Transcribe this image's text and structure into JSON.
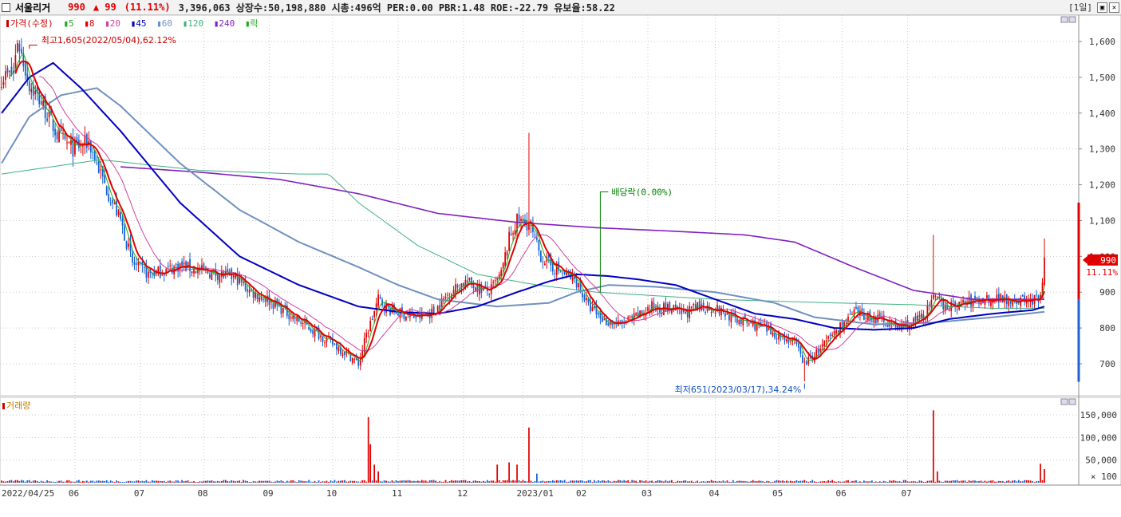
{
  "header": {
    "stock_name": "서울리거",
    "price": "990",
    "change": "▲ 99",
    "change_pct": "(11.11%)",
    "stats": "3,396,063  상장수:50,198,880  시총:496억  PER:0.00  PBR:1.48  ROE:-22.79  유보율:58.22",
    "timeframe": "[1일]"
  },
  "colors": {
    "up": "#e00000",
    "down": "#1060d0",
    "ma5": "#22aa22",
    "ma8": "#e00000",
    "ma20": "#d040a0",
    "ma45": "#0000c0",
    "ma60": "#7090c0",
    "ma120": "#40b080",
    "ma240": "#8020c0"
  },
  "legend": {
    "price": "가격(수정)",
    "ma5": "5",
    "ma8": "8",
    "ma20": "20",
    "ma45": "45",
    "ma60": "60",
    "ma120": "120",
    "ma240": "240",
    "event": "락"
  },
  "annotations": {
    "high": "최고1,605(2022/05/04),62.12%",
    "low": "최저651(2023/03/17),34.24%",
    "dividend": "배당락(0.00%)"
  },
  "price_tag": {
    "value": "990",
    "pct": "11.11%"
  },
  "volume_panel": {
    "title": "거래량",
    "unit": "× 100"
  },
  "chart_data": [
    {
      "type": "candlestick",
      "title": "",
      "ylim": [
        620,
        1650
      ],
      "y_ticks": [
        "1,600",
        "1,500",
        "1,400",
        "1,300",
        "1,200",
        "1,100",
        "1,000",
        "900",
        "800",
        "700"
      ],
      "x_tick_labels": [
        "2022/04/25",
        "06",
        "07",
        "08",
        "09",
        "10",
        "11",
        "12",
        "2023/01",
        "02",
        "03",
        "04",
        "05",
        "06",
        "07"
      ],
      "price_keypoints": [
        [
          0,
          1500
        ],
        [
          6,
          1510
        ],
        [
          8,
          1605
        ],
        [
          14,
          1480
        ],
        [
          20,
          1430
        ],
        [
          28,
          1340
        ],
        [
          36,
          1300
        ],
        [
          44,
          1320
        ],
        [
          52,
          1200
        ],
        [
          60,
          1100
        ],
        [
          66,
          980
        ],
        [
          74,
          950
        ],
        [
          82,
          960
        ],
        [
          90,
          975
        ],
        [
          100,
          960
        ],
        [
          110,
          950
        ],
        [
          118,
          940
        ],
        [
          126,
          900
        ],
        [
          134,
          880
        ],
        [
          142,
          850
        ],
        [
          150,
          820
        ],
        [
          158,
          790
        ],
        [
          166,
          760
        ],
        [
          174,
          730
        ],
        [
          180,
          700
        ],
        [
          184,
          780
        ],
        [
          190,
          880
        ],
        [
          196,
          850
        ],
        [
          202,
          840
        ],
        [
          210,
          830
        ],
        [
          218,
          845
        ],
        [
          226,
          900
        ],
        [
          234,
          930
        ],
        [
          240,
          915
        ],
        [
          246,
          900
        ],
        [
          252,
          950
        ],
        [
          256,
          1050
        ],
        [
          260,
          1100
        ],
        [
          266,
          1090
        ],
        [
          272,
          1000
        ],
        [
          278,
          970
        ],
        [
          284,
          950
        ],
        [
          290,
          930
        ],
        [
          296,
          860
        ],
        [
          304,
          820
        ],
        [
          312,
          810
        ],
        [
          320,
          830
        ],
        [
          328,
          860
        ],
        [
          336,
          855
        ],
        [
          344,
          840
        ],
        [
          352,
          860
        ],
        [
          360,
          855
        ],
        [
          368,
          830
        ],
        [
          376,
          815
        ],
        [
          384,
          800
        ],
        [
          392,
          780
        ],
        [
          400,
          760
        ],
        [
          405,
          700
        ],
        [
          410,
          725
        ],
        [
          416,
          760
        ],
        [
          422,
          800
        ],
        [
          430,
          840
        ],
        [
          438,
          830
        ],
        [
          446,
          820
        ],
        [
          452,
          800
        ],
        [
          460,
          815
        ],
        [
          466,
          840
        ],
        [
          470,
          880
        ],
        [
          474,
          870
        ],
        [
          478,
          860
        ],
        [
          486,
          870
        ],
        [
          494,
          880
        ],
        [
          502,
          885
        ],
        [
          510,
          880
        ],
        [
          518,
          875
        ],
        [
          524,
          880
        ],
        [
          526,
          990
        ]
      ],
      "ma45_keypoints": [
        [
          0,
          1400
        ],
        [
          14,
          1500
        ],
        [
          26,
          1540
        ],
        [
          40,
          1470
        ],
        [
          60,
          1350
        ],
        [
          90,
          1150
        ],
        [
          120,
          1000
        ],
        [
          150,
          920
        ],
        [
          180,
          860
        ],
        [
          200,
          845
        ],
        [
          220,
          840
        ],
        [
          240,
          860
        ],
        [
          260,
          900
        ],
        [
          276,
          930
        ],
        [
          290,
          950
        ],
        [
          306,
          945
        ],
        [
          322,
          935
        ],
        [
          340,
          920
        ],
        [
          360,
          880
        ],
        [
          380,
          840
        ],
        [
          400,
          825
        ],
        [
          420,
          800
        ],
        [
          440,
          795
        ],
        [
          460,
          800
        ],
        [
          478,
          825
        ],
        [
          500,
          840
        ],
        [
          520,
          850
        ],
        [
          526,
          860
        ]
      ],
      "ma60_keypoints": [
        [
          0,
          1260
        ],
        [
          14,
          1390
        ],
        [
          30,
          1450
        ],
        [
          48,
          1470
        ],
        [
          60,
          1420
        ],
        [
          90,
          1260
        ],
        [
          120,
          1130
        ],
        [
          150,
          1040
        ],
        [
          180,
          970
        ],
        [
          200,
          920
        ],
        [
          220,
          880
        ],
        [
          250,
          860
        ],
        [
          276,
          870
        ],
        [
          290,
          900
        ],
        [
          306,
          920
        ],
        [
          330,
          915
        ],
        [
          360,
          900
        ],
        [
          390,
          870
        ],
        [
          410,
          830
        ],
        [
          440,
          810
        ],
        [
          470,
          815
        ],
        [
          500,
          830
        ],
        [
          526,
          845
        ]
      ],
      "ma120_keypoints": [
        [
          0,
          1230
        ],
        [
          50,
          1270
        ],
        [
          100,
          1240
        ],
        [
          150,
          1230
        ],
        [
          165,
          1230
        ],
        [
          180,
          1150
        ],
        [
          210,
          1030
        ],
        [
          240,
          950
        ],
        [
          270,
          920
        ],
        [
          300,
          900
        ],
        [
          330,
          890
        ],
        [
          360,
          880
        ],
        [
          390,
          875
        ],
        [
          420,
          870
        ],
        [
          460,
          865
        ],
        [
          500,
          855
        ],
        [
          526,
          855
        ]
      ],
      "ma240_keypoints": [
        [
          60,
          1250
        ],
        [
          100,
          1235
        ],
        [
          140,
          1215
        ],
        [
          180,
          1175
        ],
        [
          220,
          1120
        ],
        [
          260,
          1095
        ],
        [
          300,
          1080
        ],
        [
          340,
          1070
        ],
        [
          375,
          1060
        ],
        [
          400,
          1040
        ],
        [
          430,
          970
        ],
        [
          460,
          905
        ],
        [
          490,
          880
        ],
        [
          526,
          880
        ]
      ],
      "dividend_day": 302,
      "n_days": 527
    },
    {
      "type": "bar",
      "title": "거래량",
      "ylim": [
        0,
        170000
      ],
      "y_ticks": [
        "150,000",
        "100,000",
        "50,000"
      ],
      "spikes": [
        [
          185,
          145000
        ],
        [
          186,
          85000
        ],
        [
          188,
          40000
        ],
        [
          190,
          25000
        ],
        [
          250,
          40000
        ],
        [
          256,
          45000
        ],
        [
          260,
          40000
        ],
        [
          266,
          122000
        ],
        [
          270,
          20000
        ],
        [
          470,
          160000
        ],
        [
          472,
          25000
        ],
        [
          524,
          42000
        ],
        [
          526,
          30000
        ]
      ]
    }
  ]
}
